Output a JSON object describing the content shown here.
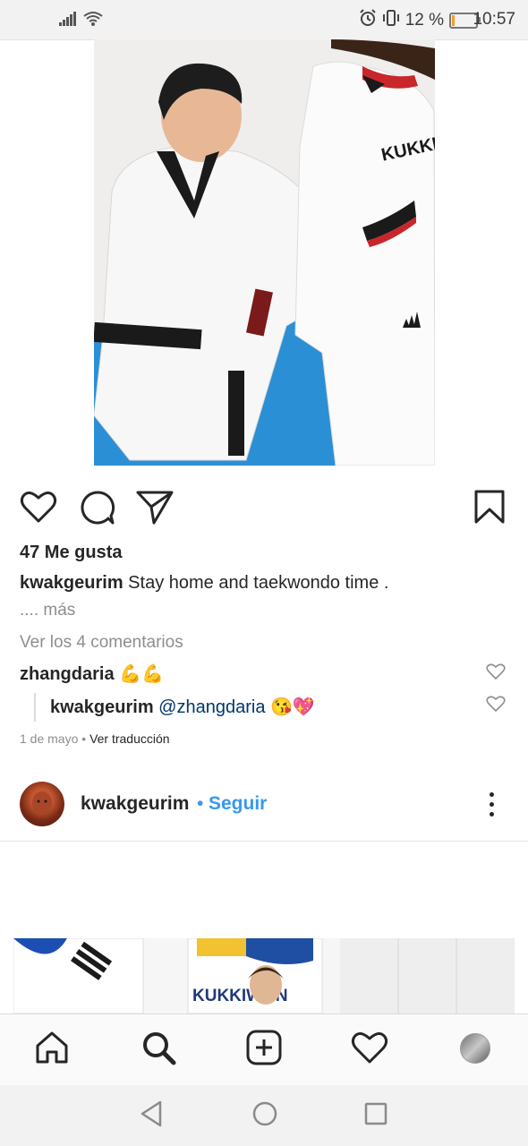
{
  "status_bar": {
    "battery_percent": "12 %",
    "time": "10:57",
    "battery_level": 0.12,
    "icons": [
      "signal-icon",
      "wifi-icon",
      "alarm-icon",
      "vibrate-icon",
      "battery-icon"
    ]
  },
  "post": {
    "photo_text": [
      "KUKKIWO"
    ],
    "actions": [
      "heart-icon",
      "comment-icon",
      "share-icon",
      "bookmark-icon"
    ],
    "likes": "47 Me gusta",
    "caption": {
      "username": "kwakgeurim",
      "text": "Stay home and taekwondo time ."
    },
    "more": ".... más",
    "view_comments": "Ver los 4 comentarios",
    "comments": [
      {
        "username": "zhangdaria",
        "text": "💪💪"
      },
      {
        "username": "kwakgeurim",
        "mention": "@zhangdaria",
        "text": "😘💖"
      }
    ],
    "date": "1 de mayo",
    "separator": "•",
    "translate": "Ver traducción"
  },
  "next_post": {
    "username": "kwakgeurim",
    "separator": "•",
    "follow": "Seguir",
    "photo_text": "KUKKIWON"
  },
  "tab_bar": {
    "items": [
      "home-icon",
      "search-icon",
      "new-post-icon",
      "activity-icon",
      "profile-icon"
    ]
  },
  "nav_bar": {
    "items": [
      "back-icon",
      "home-circle-icon",
      "recents-icon"
    ]
  },
  "colors": {
    "link": "#3897f0",
    "mention": "#00376b",
    "muted": "#8e8e8e",
    "text": "#262626",
    "battery_fill": "#f39c2a"
  }
}
